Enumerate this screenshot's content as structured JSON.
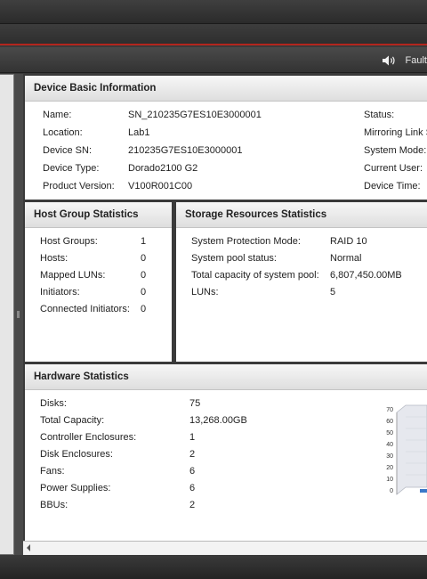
{
  "toolbar": {
    "fault_label": "Fault"
  },
  "device_info": {
    "title": "Device Basic Information",
    "rows": [
      {
        "label": "Name:",
        "value": "SN_210235G7ES10E3000001"
      },
      {
        "label": "Location:",
        "value": "Lab1"
      },
      {
        "label": "Device SN:",
        "value": "210235G7ES10E3000001"
      },
      {
        "label": "Device Type:",
        "value": "Dorado2100 G2"
      },
      {
        "label": "Product Version:",
        "value": "V100R001C00"
      }
    ],
    "right_labels": [
      "Status:",
      "Mirroring Link S",
      "System Mode:",
      "Current User:",
      "Device Time:"
    ]
  },
  "host_group": {
    "title": "Host Group Statistics",
    "rows": [
      {
        "label": "Host Groups:",
        "value": "1"
      },
      {
        "label": "Hosts:",
        "value": "0"
      },
      {
        "label": "Mapped LUNs:",
        "value": "0"
      },
      {
        "label": "Initiators:",
        "value": "0"
      },
      {
        "label": "Connected Initiators:",
        "value": "0"
      }
    ]
  },
  "storage": {
    "title": "Storage Resources Statistics",
    "rows": [
      {
        "label": "System Protection Mode:",
        "value": "RAID 10"
      },
      {
        "label": "System pool status:",
        "value": "Normal"
      },
      {
        "label": "Total capacity of system pool:",
        "value": "6,807,450.00MB"
      },
      {
        "label": "LUNs:",
        "value": "5"
      }
    ]
  },
  "hardware": {
    "title": "Hardware Statistics",
    "rows": [
      {
        "label": "Disks:",
        "value": "75"
      },
      {
        "label": "Total Capacity:",
        "value": "13,268.00GB"
      },
      {
        "label": "Controller Enclosures:",
        "value": "1"
      },
      {
        "label": "Disk Enclosures:",
        "value": "2"
      },
      {
        "label": "Fans:",
        "value": "6"
      },
      {
        "label": "Power Supplies:",
        "value": "6"
      },
      {
        "label": "BBUs:",
        "value": "2"
      }
    ],
    "chart_ticks": [
      "70",
      "60",
      "50",
      "40",
      "30",
      "20",
      "10",
      "0"
    ]
  }
}
